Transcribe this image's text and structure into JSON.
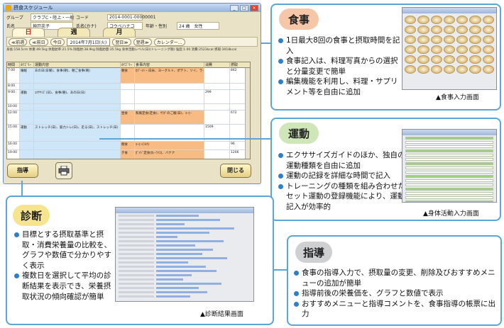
{
  "window": {
    "title": "摂食スケジュール",
    "info": [
      {
        "label": "グループ",
        "value": "クラブC・陸上・一般"
      },
      {
        "label": "コード",
        "value": "2014-0001-00000001"
      },
      {
        "label": "氏名",
        "value": "神戸花子"
      },
      {
        "label": "氏名(カナ)",
        "value": "コウベハナコ"
      },
      {
        "label": "年齢・性別",
        "value": "24 歳　女性"
      }
    ],
    "tabs": [
      "日",
      "週",
      "月"
    ],
    "datebar": {
      "prev_week": "≪前週",
      "prev_day": "≪前日",
      "today": "今日",
      "date": "2014年7月1日(火)",
      "next_day": "翌日≫",
      "next_week": "翌週≫",
      "calendar": "カレンダー..."
    },
    "summary": "身長:158.5cm 体重:49.5kg 体脂肪率:21.5% 除脂肪:38.9kg 除脂肪量:35.5kg 身体活動レベル(日)(トレーニング期) 強度:1.00 消費:2523kcal 摂取:3018kcal",
    "columns": [
      "時間",
      "ｶﾃｺﾞﾘｰ",
      "運動内容",
      "ｶﾃｺﾞﾘｰ",
      "食事内容",
      "消費",
      "摂取"
    ],
    "rows": [
      {
        "time": "7:00",
        "ex_cat": "睡眠",
        "ex": "あの日(日曜)、食事(朝)、朝ご食事(朝)",
        "meal_cat": "朝食",
        "meal": "ｶﾌﾟｰﾒﾝ・白米、ヨーグルト、ポテト、ソイ、ラッパー",
        "burn": "",
        "intake": "842"
      },
      {
        "time": "8:00",
        "ex_cat": "",
        "ex": "",
        "meal_cat": "",
        "meal": "",
        "burn": "",
        "intake": ""
      },
      {
        "time": "9:00",
        "ex_cat": "運動",
        "ex": "ｴｸｻｻｲｽﾞ(日)、食事(朝)、あの日(日)",
        "meal_cat": "",
        "meal": "",
        "burn": "299",
        "intake": ""
      },
      {
        "time": "10:00",
        "ex_cat": "",
        "ex": "",
        "meal_cat": "",
        "meal": "",
        "burn": "",
        "intake": ""
      },
      {
        "time": "12:00",
        "ex_cat": "",
        "ex": "",
        "meal_cat": "昼食",
        "meal": "和風定食(定食)、ｻﾗﾀﾞのご飯(日)、ｺｰﾋｰ",
        "burn": "",
        "intake": "672"
      },
      {
        "time": "15:00",
        "ex_cat": "運動",
        "ex": "ストレッチ(日)、筋力トレ(日)、走る(日)、ストレッチ(日)",
        "meal_cat": "",
        "meal": "",
        "burn": "1509",
        "intake": ""
      },
      {
        "time": "16:00",
        "ex_cat": "",
        "ex": "",
        "meal_cat": "間食",
        "meal": "ｺｰﾋｰ(ﾐﾙｸ)",
        "burn": "",
        "intake": "96"
      },
      {
        "time": "19:00",
        "ex_cat": "",
        "ex": "",
        "meal_cat": "夕食",
        "meal": "ｶﾞｲﾄﾞ定食(ｶﾚｰﾗｲｽ)、バナナ",
        "burn": "",
        "intake": "1206"
      }
    ],
    "buttons": {
      "guide": "指導",
      "close": "閉じる"
    }
  },
  "sections": {
    "meal": {
      "title": "食事",
      "items": [
        "1日最大8回の食事と摂取時間を記入",
        "食事記入は、料理写真からの選択と分量変更で簡単",
        "編集機能を利用し、料理・サプリメント等を自由に追加"
      ],
      "caption": "▲食事入力画面"
    },
    "exercise": {
      "title": "運動",
      "items": [
        "エクササイズガイドのほか、独自の運動種類を自由に追加",
        "運動の記録を詳細な時間で記入",
        "トレーニングの種類を組み合わせたセット運動の登録機能により、運動記入が効率的"
      ],
      "caption": "▲身体活動入力画面"
    },
    "diagnosis": {
      "title": "診断",
      "items": [
        "目標とする摂取基準と摂取・消費栄養量の比較を、グラフや数値で分かりやすく表示",
        "複数日を選択して平均の診断結果を表示でき、栄養摂取状況の傾向確認が簡単"
      ],
      "caption": "▲診断結果画面"
    },
    "guidance": {
      "title": "指導",
      "items": [
        "食事の指導入力で、摂取量の変更、削除及びおすすめメニューの追加が簡単",
        "指導前後の栄養価を、グラフと数値で表示",
        "おすすめメニューと指導コメントを、食事指導の帳票に出力"
      ]
    }
  },
  "colors": {
    "accent": "#5aa6d8",
    "meal_pill": "#f5c7a8",
    "exercise_pill": "#cfe6b8",
    "diagnosis_pill": "#f6e48e",
    "guidance_pill": "#cfd0d2",
    "bullet": "#2f7fc7"
  }
}
